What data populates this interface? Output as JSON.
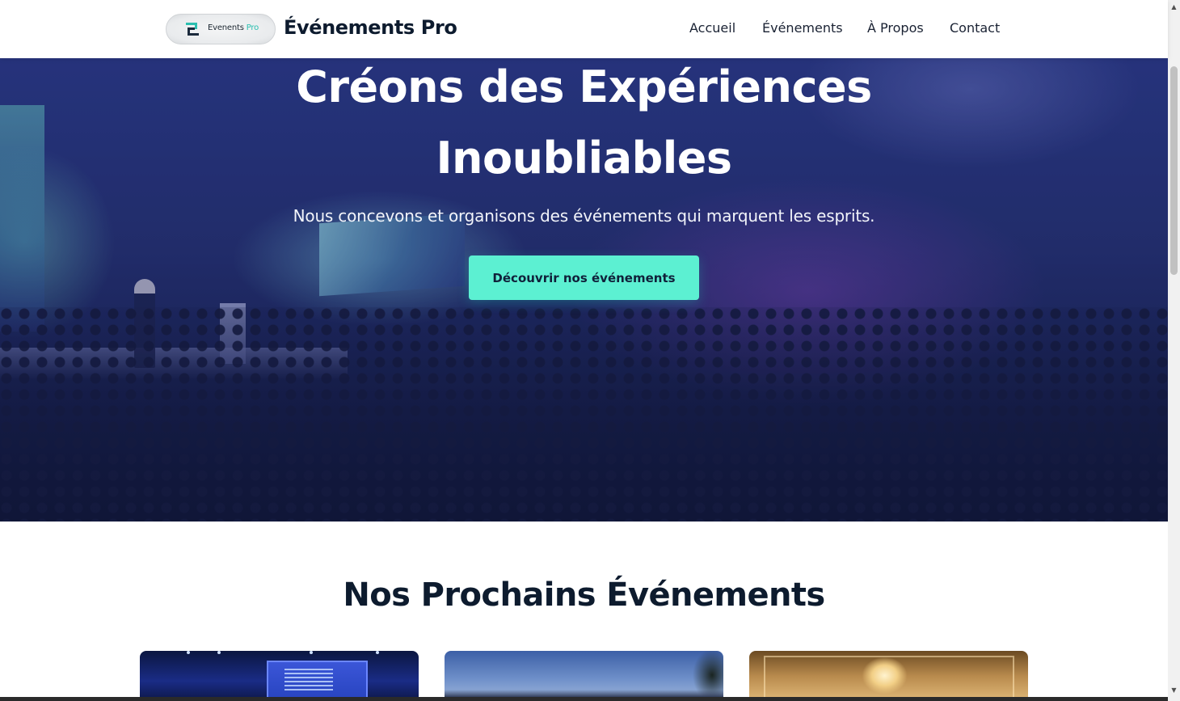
{
  "header": {
    "logo_text": "Evenents",
    "logo_text_accent": "Pro",
    "brand_name": "Événements Pro",
    "nav": [
      {
        "label": "Accueil"
      },
      {
        "label": "Événements"
      },
      {
        "label": "À Propos"
      },
      {
        "label": "Contact"
      }
    ]
  },
  "hero": {
    "title_line1": "Créons des Expériences",
    "title_line2": "Inoubliables",
    "subtitle": "Nous concevons et organisons des événements qui marquent les esprits.",
    "cta_label": "Découvrir nos événements"
  },
  "events": {
    "section_title": "Nos Prochains Événements"
  },
  "colors": {
    "accent": "#5cf0d2",
    "heading": "#0d1b2e",
    "hero_tint": "#27357d"
  },
  "icons": {
    "logo": "events-pro-logo-icon",
    "scroll_up": "chevron-up-icon",
    "scroll_down": "chevron-down-icon"
  }
}
